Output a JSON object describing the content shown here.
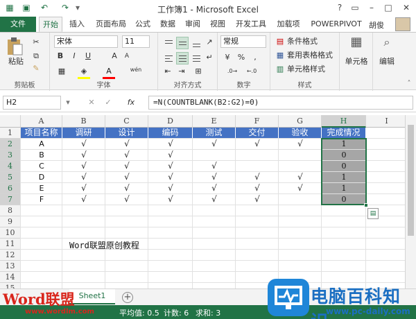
{
  "titlebar": {
    "title": "工作簿1 - Microsoft Excel",
    "controls": [
      "?",
      "▭",
      "–",
      "□",
      "✕"
    ]
  },
  "tabs": {
    "file": "文件",
    "items": [
      "开始",
      "插入",
      "页面布局",
      "公式",
      "数据",
      "审阅",
      "视图",
      "开发工具",
      "加载项",
      "POWERPIVOT"
    ],
    "active": "开始",
    "user": "胡俊"
  },
  "ribbon": {
    "clipboard": {
      "paste": "粘贴",
      "label": "剪贴板"
    },
    "font": {
      "name": "宋体",
      "size": "11",
      "label": "字体",
      "bold": "B",
      "italic": "I",
      "underline": "U",
      "grow": "A",
      "shrink": "A",
      "wen": "wén"
    },
    "alignment": {
      "label": "对齐方式"
    },
    "number": {
      "format": "常规",
      "label": "数字"
    },
    "styles": {
      "conditional": "条件格式",
      "table": "套用表格格式",
      "cell": "单元格样式",
      "label": "样式"
    },
    "cells": {
      "label": "单元格"
    },
    "editing": {
      "label": "编辑"
    }
  },
  "formula_bar": {
    "name_box": "H2",
    "fx": "fx",
    "formula": "=N(COUNTBLANK(B2:G2)=0)"
  },
  "grid": {
    "columns": [
      "A",
      "B",
      "C",
      "D",
      "E",
      "F",
      "G",
      "H",
      "I"
    ],
    "selected_column": "H",
    "rows": [
      "1",
      "2",
      "3",
      "4",
      "5",
      "6",
      "7",
      "8",
      "9",
      "10",
      "11",
      "12",
      "13",
      "14",
      "15"
    ],
    "selected_rows": [
      "2",
      "3",
      "4",
      "5",
      "6",
      "7"
    ],
    "headers": [
      "项目名称",
      "调研",
      "设计",
      "编码",
      "测试",
      "交付",
      "验收",
      "完成情况"
    ],
    "check_mark": "√",
    "data": [
      {
        "name": "A",
        "checks": [
          true,
          true,
          true,
          true,
          true,
          true
        ],
        "result": "1"
      },
      {
        "name": "B",
        "checks": [
          true,
          true,
          true,
          false,
          false,
          false
        ],
        "result": "0"
      },
      {
        "name": "C",
        "checks": [
          true,
          true,
          true,
          true,
          false,
          false
        ],
        "result": "0"
      },
      {
        "name": "D",
        "checks": [
          true,
          true,
          true,
          true,
          true,
          true
        ],
        "result": "1"
      },
      {
        "name": "E",
        "checks": [
          true,
          true,
          true,
          true,
          true,
          true
        ],
        "result": "1"
      },
      {
        "name": "F",
        "checks": [
          true,
          true,
          true,
          true,
          true,
          false
        ],
        "result": "0"
      }
    ],
    "note": "Word联盟原创教程"
  },
  "sheet_bar": {
    "sheet_name": "Sheet1",
    "add": "+"
  },
  "status_bar": {
    "average": "平均值: 0.5",
    "count": "计数: 6",
    "sum": "求和: 3"
  },
  "watermarks": {
    "left_title": "Word联盟",
    "left_url": "www.wordlm.com",
    "right_title": "电脑百科知识",
    "right_url": "www.pc-daily.com"
  },
  "colors": {
    "excel_green": "#217346",
    "header_blue": "#4472c4",
    "selection_gray": "#a6a6a6"
  }
}
